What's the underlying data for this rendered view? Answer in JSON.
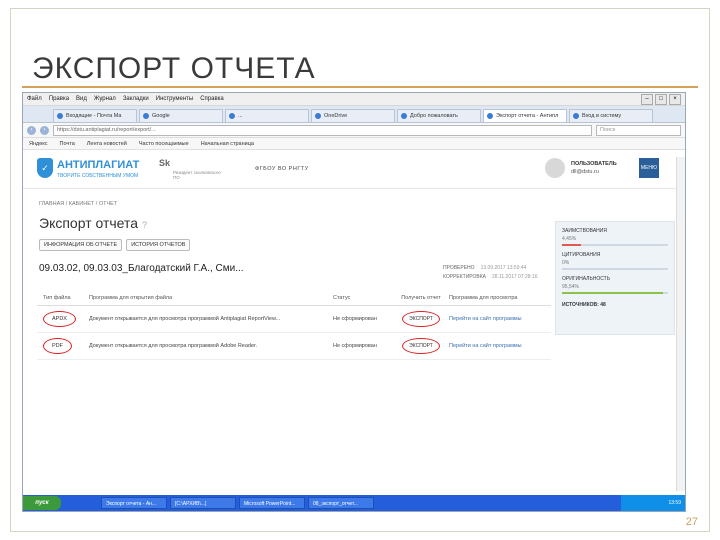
{
  "slide": {
    "title": "ЭКСПОРТ ОТЧЕТА",
    "number": "27"
  },
  "browser": {
    "menu": [
      "Файл",
      "Правка",
      "Вид",
      "Журнал",
      "Закладки",
      "Инструменты",
      "Справка"
    ],
    "tabs": [
      {
        "label": "Входящие - Почта Ма",
        "active": false
      },
      {
        "label": "Google",
        "active": false
      },
      {
        "label": "...",
        "active": false
      },
      {
        "label": "OneDrive",
        "active": false
      },
      {
        "label": "Добро пожаловать",
        "active": false
      },
      {
        "label": "Экспорт отчета - Антипл",
        "active": true
      },
      {
        "label": "Вход в систему",
        "active": false
      }
    ],
    "url": "https://dstu.antiplagiat.ru/report/export/...",
    "search_placeholder": "Поиск",
    "bookmarks": [
      "Яндекс",
      "Почта",
      "Лента новостей",
      "Часто посещаемые",
      "Начальная страница"
    ]
  },
  "header": {
    "logo_text": "АНТИПЛАГИАТ",
    "logo_sub": "ТВОРИТЕ СОБСТВЕННЫМ УМОМ",
    "sk_logo": "Sk",
    "sk_sub": "Резидент сколковского ПО",
    "about": "ФГБОУ ВО РНГТУ",
    "user_role": "ПОЛЬЗОВАТЕЛЬ",
    "user_mail": "dll@dstu.ru",
    "menu": "МЕНЮ"
  },
  "page": {
    "breadcrumbs": "ГЛАВНАЯ / КАБИНЕТ / ОТЧЕТ",
    "heading": "Экспорт отчета",
    "help": "?",
    "buttons": [
      "ИНФОРМАЦИЯ ОБ ОТЧЕТЕ",
      "ИСТОРИЯ ОТЧЕТОВ"
    ],
    "doc_title": "09.03.02, 09.03.03_Благодатский Г.А., Сми...",
    "checked_label": "ПРОВЕРЕНО",
    "checked_value": "13.09.2017 13:59:44",
    "corrected_label": "КОРРЕКТИРОВКА",
    "corrected_value": "28.11.2017 07:28:16"
  },
  "table": {
    "headers": [
      "Тип файла",
      "Программа для открытия файла",
      "Статус",
      "Получить отчет",
      "Программа для просмотра"
    ],
    "rows": [
      {
        "type": "APDX",
        "program": "Документ открывается для просмотра программой Antiplagiat ReportView...",
        "status": "Не сформирован",
        "action": "ЭКСПОРТ",
        "viewer": "Перейти на сайт программы"
      },
      {
        "type": "PDF",
        "program": "Документ открывается для просмотра программой Adobe Reader.",
        "status": "Не сформирован",
        "action": "ЭКСПОРТ",
        "viewer": "Перейти на сайт программы"
      }
    ]
  },
  "sidebar": {
    "borrowings_label": "ЗАИМСТВОВАНИЯ",
    "borrowings_value": "4,45%",
    "borrowings_fraction": 0.18,
    "citations_label": "ЦИТИРОВАНИЯ",
    "citations_value": "0%",
    "citations_fraction": 0.0,
    "originality_label": "ОРИГИНАЛЬНОСТЬ",
    "originality_value": "95,54%",
    "originality_fraction": 0.95,
    "sources_label": "ИСТОЧНИКОВ: 48"
  },
  "taskbar": {
    "start": "пуск",
    "tasks": [
      "Экспорт отчета - Ан...",
      "[С:\\АРХИВ\\...]",
      "Microsoft PowerPoint...",
      "08_экспорт_отчет..."
    ],
    "tray": "13:59"
  },
  "colors": {
    "brand": "#2f8fd8",
    "highlight": "#dd2222",
    "taskbar": "#245edb"
  }
}
